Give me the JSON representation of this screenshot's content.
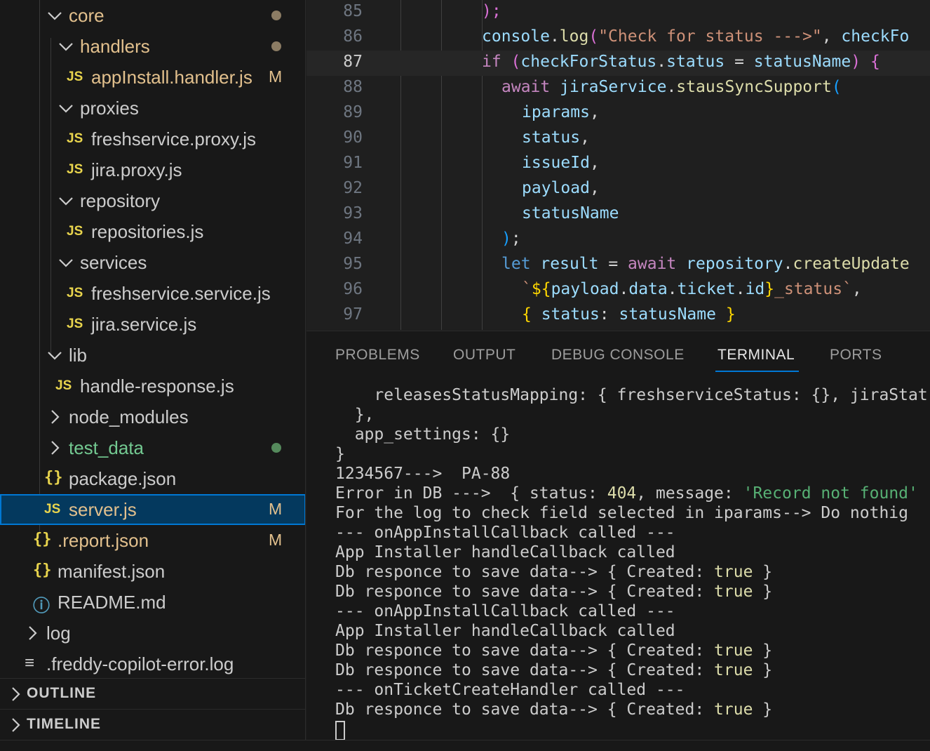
{
  "explorer": {
    "items": [
      {
        "label": "core",
        "kind": "folder-open",
        "status": "modified-dot"
      },
      {
        "label": "handlers",
        "kind": "folder-open",
        "status": "modified-dot"
      },
      {
        "label": "appInstall.handler.js",
        "kind": "js",
        "badge": "M"
      },
      {
        "label": "proxies",
        "kind": "folder-open"
      },
      {
        "label": "freshservice.proxy.js",
        "kind": "js"
      },
      {
        "label": "jira.proxy.js",
        "kind": "js"
      },
      {
        "label": "repository",
        "kind": "folder-open"
      },
      {
        "label": "repositories.js",
        "kind": "js"
      },
      {
        "label": "services",
        "kind": "folder-open"
      },
      {
        "label": "freshservice.service.js",
        "kind": "js"
      },
      {
        "label": "jira.service.js",
        "kind": "js"
      },
      {
        "label": "lib",
        "kind": "folder-open"
      },
      {
        "label": "handle-response.js",
        "kind": "js"
      },
      {
        "label": "node_modules",
        "kind": "folder-closed"
      },
      {
        "label": "test_data",
        "kind": "folder-closed",
        "status": "untracked-dot"
      },
      {
        "label": "package.json",
        "kind": "json"
      },
      {
        "label": "server.js",
        "kind": "js",
        "badge": "M",
        "selected": true
      },
      {
        "label": ".report.json",
        "kind": "json",
        "badge": "M"
      },
      {
        "label": "manifest.json",
        "kind": "json"
      },
      {
        "label": "README.md",
        "kind": "info"
      },
      {
        "label": "log",
        "kind": "folder-closed"
      },
      {
        "label": ".freddy-copilot-error.log",
        "kind": "lines"
      }
    ],
    "icon_text": {
      "js": "JS",
      "json": "{}",
      "info": "ⓘ",
      "lines": "≡"
    },
    "sections": [
      {
        "label": "OUTLINE"
      },
      {
        "label": "TIMELINE"
      }
    ]
  },
  "editor": {
    "line_numbers": [
      "85",
      "86",
      "87",
      "88",
      "89",
      "90",
      "91",
      "92",
      "93",
      "94",
      "95",
      "96",
      "97"
    ],
    "active_line": "87",
    "lines": {
      "l85": {
        "p1": ");"
      },
      "l86": {
        "obj": "console",
        "dot": ".",
        "fn": "log",
        "open": "(",
        "str": "\"Check for status --->\"",
        "comma": ", ",
        "arg": "checkFo"
      },
      "l87": {
        "kw": "if",
        "open": " (",
        "a": "checkForStatus",
        "dot": ".",
        "b": "status",
        "op": " = ",
        "c": "statusName",
        "close": ")",
        "brace": " {"
      },
      "l88": {
        "kw": "await",
        "obj": "jiraService",
        "dot": ".",
        "fn": "stausSyncSupport",
        "open": "("
      },
      "l89": {
        "v": "iparams",
        "p": ","
      },
      "l90": {
        "v": "status",
        "p": ","
      },
      "l91": {
        "v": "issueId",
        "p": ","
      },
      "l92": {
        "v": "payload",
        "p": ","
      },
      "l93": {
        "v": "statusName"
      },
      "l94": {
        "close": ")",
        "semi": ";"
      },
      "l95": {
        "kw": "let",
        "v": "result",
        "op": " = ",
        "kw2": "await",
        "obj": "repository",
        "dot": ".",
        "fn": "createUpdate"
      },
      "l96": {
        "tick": "`",
        "dollar": "${",
        "a": "payload",
        "d1": ".",
        "b": "data",
        "d2": ".",
        "c": "ticket",
        "d3": ".",
        "d": "id",
        "end": "}",
        "rest": "_status",
        "tick2": "`",
        "comma": ","
      },
      "l97": {
        "open": "{",
        "key": " status",
        "colon": ": ",
        "v": "statusName",
        "close": " }"
      }
    }
  },
  "panel": {
    "tabs": [
      "PROBLEMS",
      "OUTPUT",
      "DEBUG CONSOLE",
      "TERMINAL",
      "PORTS"
    ],
    "active_tab": "TERMINAL",
    "terminal": {
      "t1": "    releasesStatusMapping: { freshserviceStatus: {}, jiraStat",
      "t2": "  },",
      "t3": "  app_settings: {}",
      "t4": "}",
      "t5": "1234567--->  PA-88",
      "t6a": "Error in DB --->  { status: ",
      "t6b": "404",
      "t6c": ", message: ",
      "t6d": "'Record not found'",
      "t7": "For the log to check field selected in iparams--> Do nothig",
      "t8": "--- onAppInstallCallback called ---",
      "t9": "App Installer handleCallback called",
      "t10a": "Db responce to save data--> { Created: ",
      "t10b": "true",
      "t10c": " }",
      "t11a": "Db responce to save data--> { Created: ",
      "t11b": "true",
      "t11c": " }",
      "t12": "--- onAppInstallCallback called ---",
      "t13": "App Installer handleCallback called",
      "t14a": "Db responce to save data--> { Created: ",
      "t14b": "true",
      "t14c": " }",
      "t15a": "Db responce to save data--> { Created: ",
      "t15b": "true",
      "t15c": " }",
      "t16": "--- onTicketCreateHandler called ---",
      "t17a": "Db responce to save data--> { Created: ",
      "t17b": "true",
      "t17c": " }"
    }
  },
  "colors": {
    "selection": "#04395e",
    "focus_border": "#0078d4",
    "modified": "#e2c08d",
    "untracked": "#73c991",
    "js_icon": "#e8d44d"
  }
}
